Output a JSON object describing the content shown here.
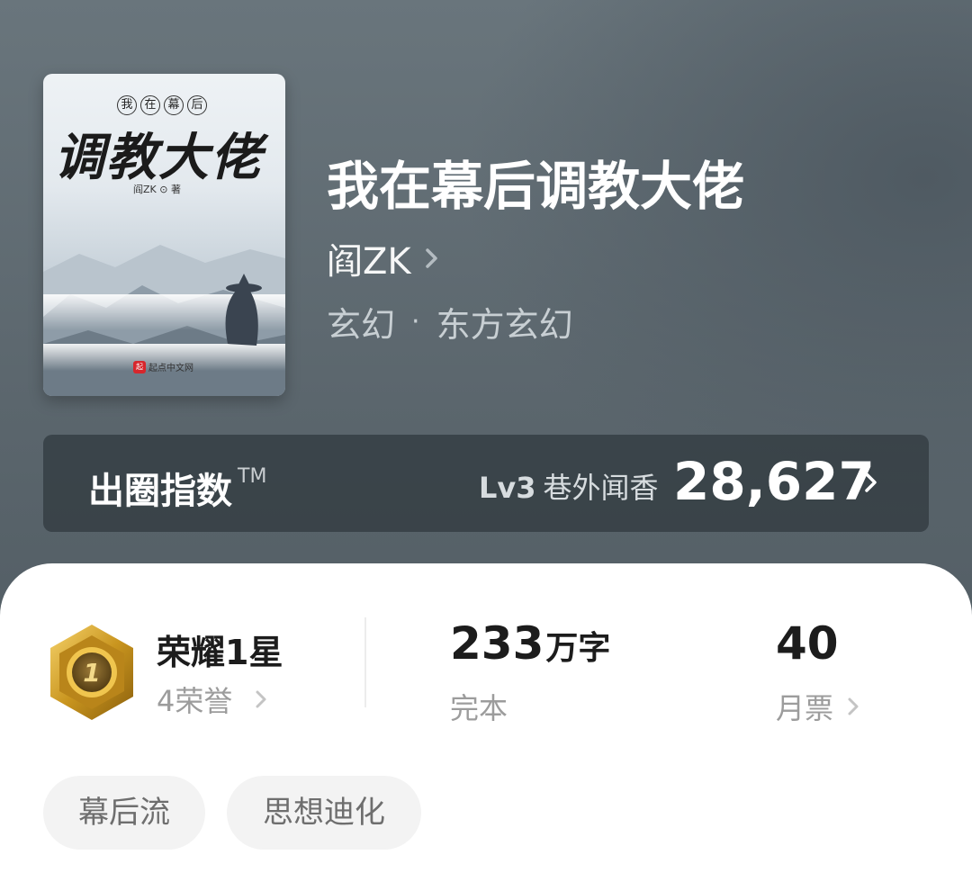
{
  "cover": {
    "small_chars": [
      "我",
      "在",
      "幕",
      "后"
    ],
    "big_title": "调教大佬",
    "author_mini": "阎ZK ⊙ 著",
    "publisher": "起点中文网",
    "publisher_logo_char": "起"
  },
  "book": {
    "title": "我在幕后调教大佬",
    "author": "阎ZK",
    "genre_main": "玄幻",
    "genre_separator": "·",
    "genre_sub": "东方玄幻"
  },
  "index_bar": {
    "label": "出圈指数",
    "trademark": "TM",
    "level": "Lv3",
    "level_name": "巷外闻香",
    "score": "28,627"
  },
  "stats": {
    "honor_title": "荣耀1星",
    "honor_count": "4荣誉",
    "badge_number": "1",
    "word_count": "233",
    "word_unit": "万字",
    "status": "完本",
    "monthly_tickets": "40",
    "monthly_tickets_label": "月票"
  },
  "tags": [
    "幕后流",
    "思想迪化"
  ],
  "colors": {
    "header_bg": "#5e6a71",
    "index_bar_bg": "#3a444a",
    "badge_gold": "#c9951f",
    "tag_bg": "#f3f3f3"
  }
}
